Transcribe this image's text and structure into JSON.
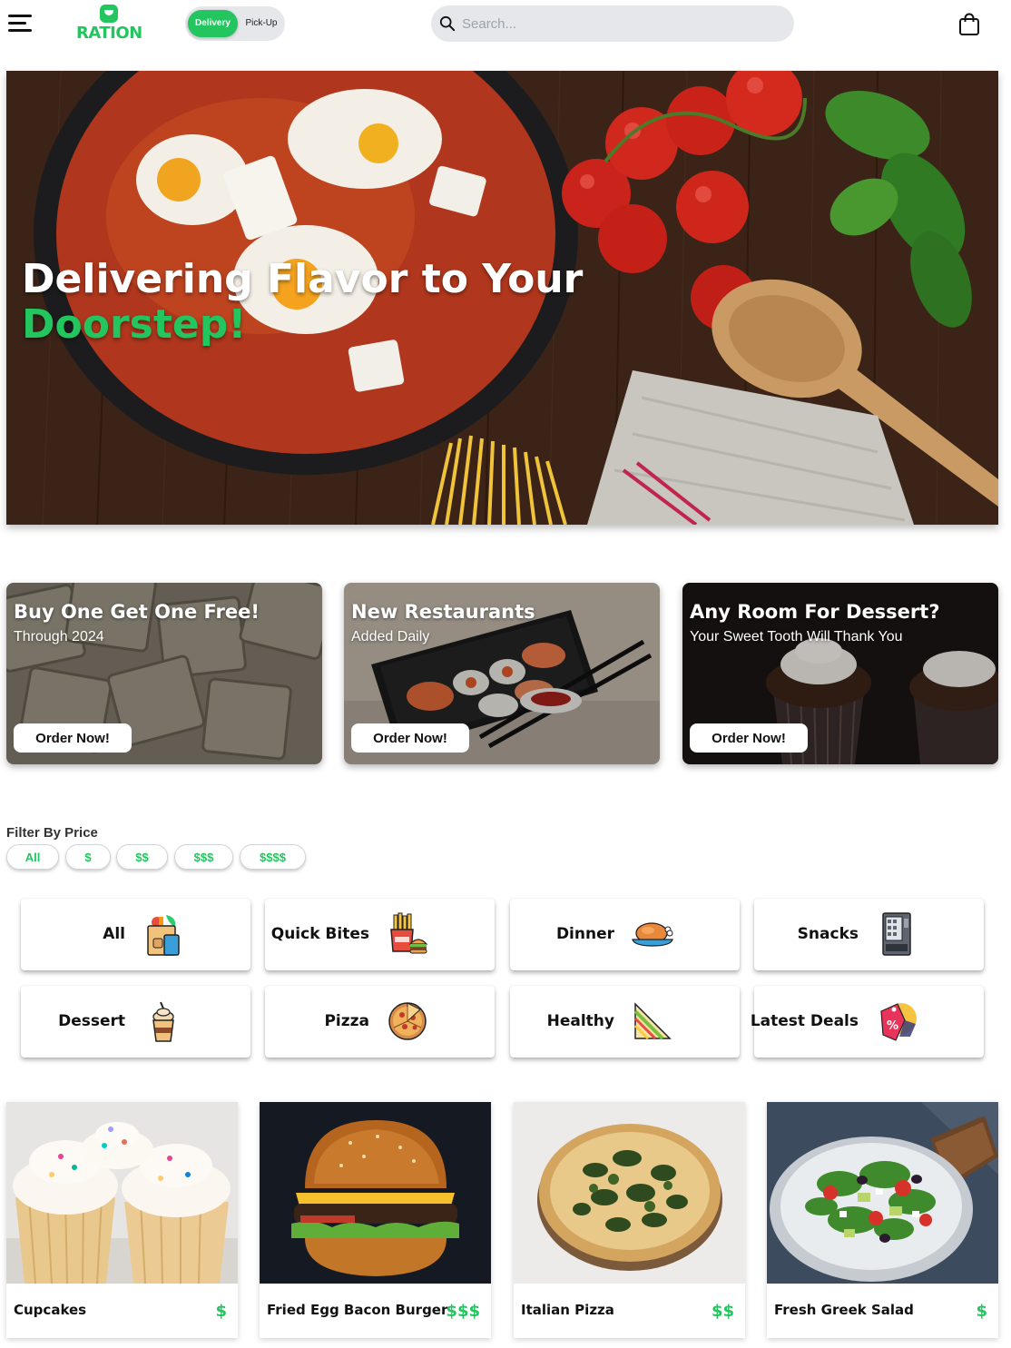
{
  "header": {
    "logo_text": "RATION",
    "delivery_label": "Delivery",
    "pickup_label": "Pick-Up",
    "search_placeholder": "Search...",
    "accent_color": "#22c55e"
  },
  "hero": {
    "title_line1": "Delivering Flavor to Your",
    "title_line2": "Doorstep!"
  },
  "promos": [
    {
      "title": "Buy One Get One Free!",
      "subtitle": "Through 2024",
      "button": "Order Now!"
    },
    {
      "title": "New Restaurants",
      "subtitle": "Added Daily",
      "button": "Order Now!"
    },
    {
      "title": "Any Room For Dessert?",
      "subtitle": "Your Sweet Tooth Will Thank You",
      "button": "Order Now!"
    }
  ],
  "filter": {
    "label": "Filter By Price",
    "options": [
      "All",
      "$",
      "$$",
      "$$$",
      "$$$$"
    ]
  },
  "categories": [
    {
      "label": "All",
      "icon": "grocery-bag-icon"
    },
    {
      "label": "Quick Bites",
      "icon": "fries-burger-icon"
    },
    {
      "label": "Dinner",
      "icon": "roast-chicken-icon"
    },
    {
      "label": "Snacks",
      "icon": "vending-machine-icon"
    },
    {
      "label": "Dessert",
      "icon": "ice-cream-cup-icon"
    },
    {
      "label": "Pizza",
      "icon": "pizza-icon"
    },
    {
      "label": "Healthy",
      "icon": "sandwich-icon"
    },
    {
      "label": "Latest Deals",
      "icon": "discount-tag-icon"
    }
  ],
  "foods": [
    {
      "name": "Cupcakes",
      "price": "$"
    },
    {
      "name": "Fried Egg Bacon Burger",
      "price": "$$$"
    },
    {
      "name": "Italian Pizza",
      "price": "$$"
    },
    {
      "name": "Fresh Greek Salad",
      "price": "$"
    }
  ]
}
